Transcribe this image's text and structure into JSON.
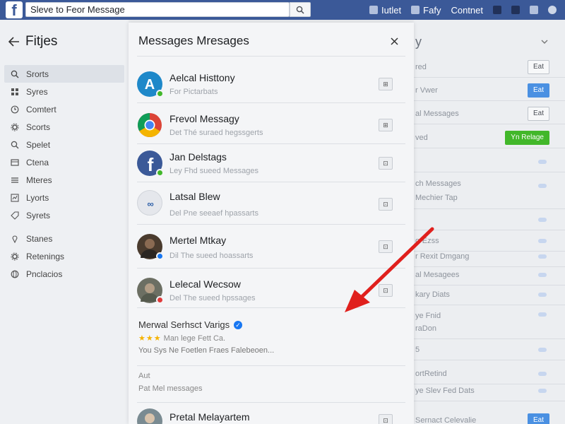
{
  "topbar": {
    "logo": "f",
    "search_value": "Sleve to Feor Message",
    "nav": [
      {
        "label": "Iutlet",
        "icon": "home-icon"
      },
      {
        "label": "Fafy",
        "icon": "friends-icon"
      },
      {
        "label": "Contnet",
        "icon": ""
      }
    ]
  },
  "sidebar": {
    "title": "Fitjes",
    "items": [
      {
        "label": "Srorts",
        "icon": "search-icon"
      },
      {
        "label": "Syres",
        "icon": "grid-icon"
      },
      {
        "label": "Comtert",
        "icon": "clock-icon"
      },
      {
        "label": "Scorts",
        "icon": "gear-icon"
      },
      {
        "label": "Spelet",
        "icon": "search-icon"
      },
      {
        "label": "Ctena",
        "icon": "list-icon"
      },
      {
        "label": "Mteres",
        "icon": "list-icon"
      },
      {
        "label": "Lyorts",
        "icon": "chart-icon"
      },
      {
        "label": "Syrets",
        "icon": "tag-icon"
      },
      {
        "label": "Stanes",
        "icon": "pin-icon"
      },
      {
        "label": "Retenings",
        "icon": "gear-icon"
      },
      {
        "label": "Pnclacios",
        "icon": "globe-icon"
      }
    ]
  },
  "dialog": {
    "title": "Messages Mresages",
    "messages": [
      {
        "name": "Aelcal Histtony",
        "sub": "For Pictarbats",
        "action": "⊞"
      },
      {
        "name": "Frevol Messagy",
        "sub": "Det Thé suraed hegssgerts",
        "action": "⊞"
      },
      {
        "name": "Jan Delstags",
        "sub": "Ley Fhd sueed Messages",
        "action": "⊡"
      },
      {
        "name": "Latsal Blew",
        "sub": "Del Pne seeaef hpassarts",
        "action": "⊡"
      },
      {
        "name": "Mertel Mtkay",
        "sub": "Dil The sueed hoassarts",
        "action": "⊡"
      },
      {
        "name": "Lelecal Wecsow",
        "sub": "Del The sueed hpssages",
        "action": "⊡"
      }
    ],
    "page_section": {
      "title": "Merwal Serhsct Varigs",
      "rating_line": "Man lege Fett Ca.",
      "desc": "You Sys Ne Foetlen Fraes Falebeoen..."
    },
    "other_section": {
      "label": "Aut",
      "text": "Pat Mel messages"
    },
    "last": {
      "name": "Pretal Melayartem"
    }
  },
  "right_panel": {
    "rows": [
      {
        "label": "red",
        "button": "Eat"
      },
      {
        "label": "r Vwer",
        "button": "Eat"
      },
      {
        "label": "al Messages",
        "button": "Eat"
      },
      {
        "label": "ved",
        "button": "Yn Relage"
      },
      {
        "label": "",
        "button": ""
      },
      {
        "label": "ch Messages",
        "button": ""
      },
      {
        "label": "Mechier Tap",
        "button": ""
      },
      {
        "label": "",
        "button": ""
      },
      {
        "label": "o-Ezss",
        "button": ""
      },
      {
        "label": "r Rexit Dmgang",
        "button": ""
      },
      {
        "label": "al Mesagees",
        "button": ""
      },
      {
        "label": "kary Diats",
        "button": ""
      },
      {
        "label": "ye Fnid",
        "button": ""
      },
      {
        "label": "raDon",
        "button": ""
      },
      {
        "label": "5",
        "button": ""
      },
      {
        "label": "ortRetind",
        "button": ""
      },
      {
        "label": "ye Slev Fed Dats",
        "button": ""
      },
      {
        "label": "Sernact Celevalie",
        "button": "Eat"
      }
    ]
  },
  "colors": {
    "brand": "#3b5998",
    "accent_blue": "#4a90e2",
    "accent_green": "#42b72a",
    "arrow_red": "#e0201d"
  }
}
